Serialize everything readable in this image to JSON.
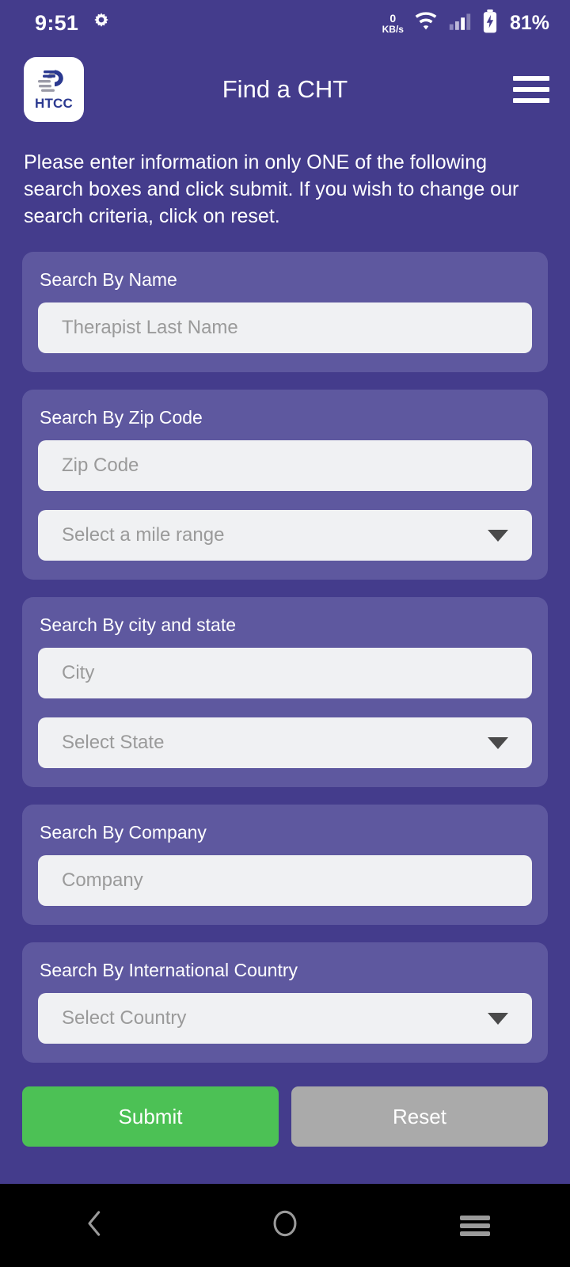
{
  "status_bar": {
    "time": "9:51",
    "settings_icon": "gear-icon",
    "net_speed_value": "0",
    "net_speed_unit": "KB/s",
    "wifi_icon": "wifi-icon",
    "signal_icon": "cellular-signal-icon",
    "battery_icon": "battery-charging-icon",
    "battery_percent": "81%"
  },
  "app_bar": {
    "logo_text": "HTCC",
    "logo_icon": "htcc-hand-logo-icon",
    "title": "Find a CHT",
    "menu_icon": "hamburger-menu-icon"
  },
  "intro": {
    "text": "Please enter information in only ONE of the following search boxes and click submit. If you wish to change our search criteria, click on reset."
  },
  "cards": [
    {
      "title": "Search By Name",
      "fields": [
        {
          "type": "text",
          "placeholder": "Therapist Last Name",
          "value": ""
        }
      ]
    },
    {
      "title": "Search By Zip Code",
      "fields": [
        {
          "type": "text",
          "placeholder": "Zip Code",
          "value": ""
        },
        {
          "type": "select",
          "placeholder": "Select a mile range",
          "value": ""
        }
      ]
    },
    {
      "title": "Search By city and state",
      "fields": [
        {
          "type": "text",
          "placeholder": "City",
          "value": ""
        },
        {
          "type": "select",
          "placeholder": "Select State",
          "value": ""
        }
      ]
    },
    {
      "title": "Search By Company",
      "fields": [
        {
          "type": "text",
          "placeholder": "Company",
          "value": ""
        }
      ]
    },
    {
      "title": "Search By International Country",
      "fields": [
        {
          "type": "select",
          "placeholder": "Select Country",
          "value": ""
        }
      ]
    }
  ],
  "actions": {
    "submit_label": "Submit",
    "reset_label": "Reset"
  },
  "nav_bar": {
    "back_icon": "back-chevron-icon",
    "home_icon": "home-circle-icon",
    "recents_icon": "recents-icon"
  },
  "colors": {
    "background": "#443C8C",
    "card": "#5E589F",
    "field": "#F0F1F3",
    "submit": "#4CC155",
    "reset": "#AAAAAA",
    "nav_bar": "#000000"
  }
}
